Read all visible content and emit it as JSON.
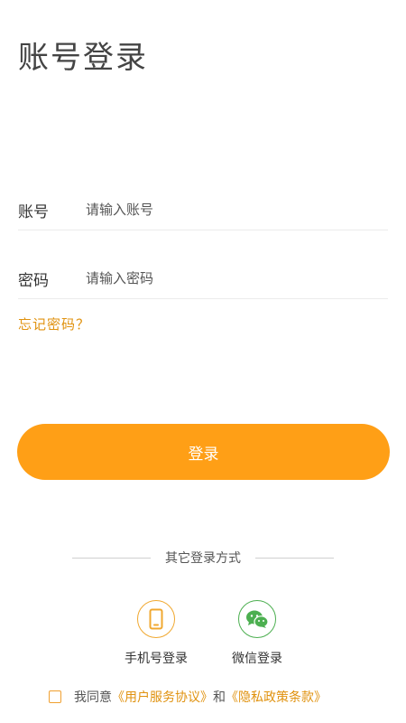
{
  "page": {
    "title": "账号登录"
  },
  "form": {
    "account": {
      "label": "账号",
      "placeholder": "请输入账号",
      "value": ""
    },
    "password": {
      "label": "密码",
      "placeholder": "请输入密码",
      "value": ""
    },
    "forgot_label": "忘记密码？",
    "login_label": "登录"
  },
  "alt_login": {
    "divider_text": "其它登录方式",
    "options": [
      {
        "label": "手机号登录",
        "icon": "phone-icon"
      },
      {
        "label": "微信登录",
        "icon": "wechat-icon"
      }
    ]
  },
  "agreement": {
    "prefix": "我同意",
    "terms_link": "《用户服务协议》",
    "and": "和",
    "privacy_link": "《隐私政策条款》",
    "checked": false
  },
  "colors": {
    "accent": "#ff9f16",
    "link": "#e0920f",
    "wechat_green": "#4caf50"
  }
}
